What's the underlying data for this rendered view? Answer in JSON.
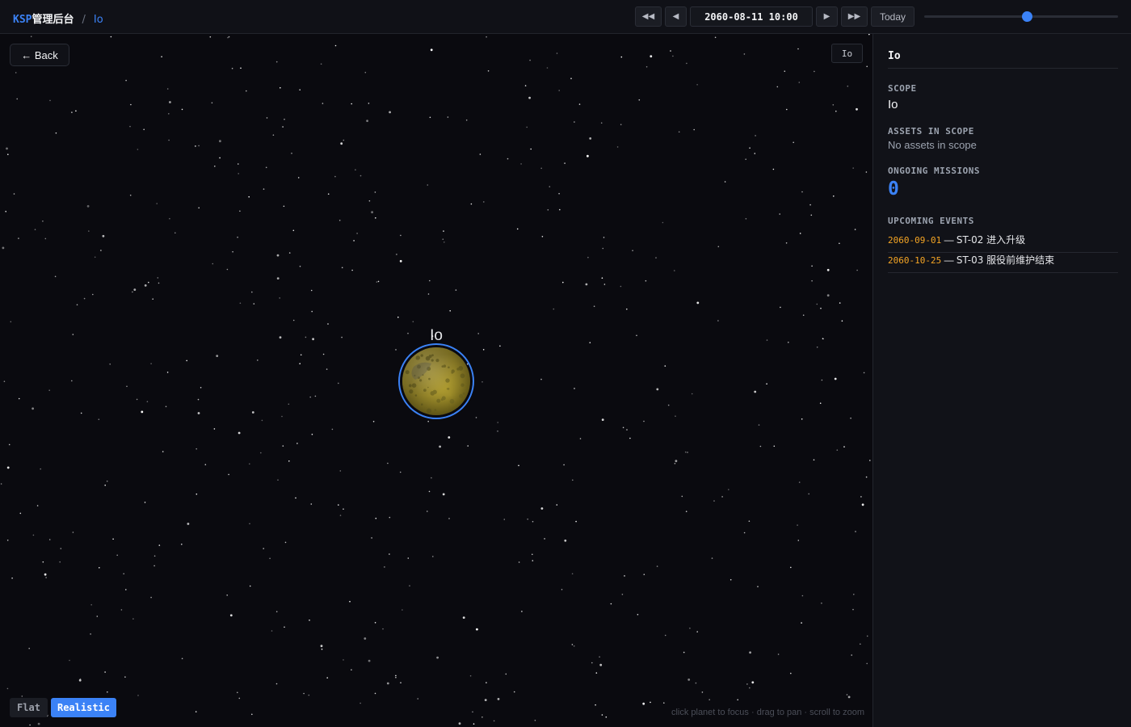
{
  "header": {
    "brand_ksp": "KSP",
    "brand_cn": "管理后台",
    "separator": "/",
    "breadcrumb": "Io"
  },
  "time_controls": {
    "rewind_fast": "◀◀",
    "step_back": "◀",
    "datetime": "2060-08-11 10:00",
    "step_forward": "▶",
    "forward_fast": "▶▶",
    "today_label": "Today",
    "timeline_position": 0.53
  },
  "viewport": {
    "back_label": "← Back",
    "scope_chip": "Io",
    "planet_name": "Io",
    "hint": "click planet to focus · drag to pan · scroll to zoom",
    "mode_flat": "Flat",
    "mode_realistic": "Realistic",
    "active_mode": "Realistic"
  },
  "panel": {
    "title": "Io",
    "scope_label": "SCOPE",
    "scope_value": "Io",
    "assets_label": "ASSETS IN SCOPE",
    "assets_value": "No assets in scope",
    "missions_label": "ONGOING MISSIONS",
    "missions_value": "0",
    "events_label": "UPCOMING EVENTS",
    "events": [
      {
        "date": "2060-09-01",
        "sep": "—",
        "text": "ST-02 进入升级"
      },
      {
        "date": "2060-10-25",
        "sep": "—",
        "text": "ST-03 服役前维护结束"
      }
    ]
  },
  "colors": {
    "accent": "#3b82f6",
    "event_date": "#f5a524",
    "planet": "#c9b53a"
  }
}
